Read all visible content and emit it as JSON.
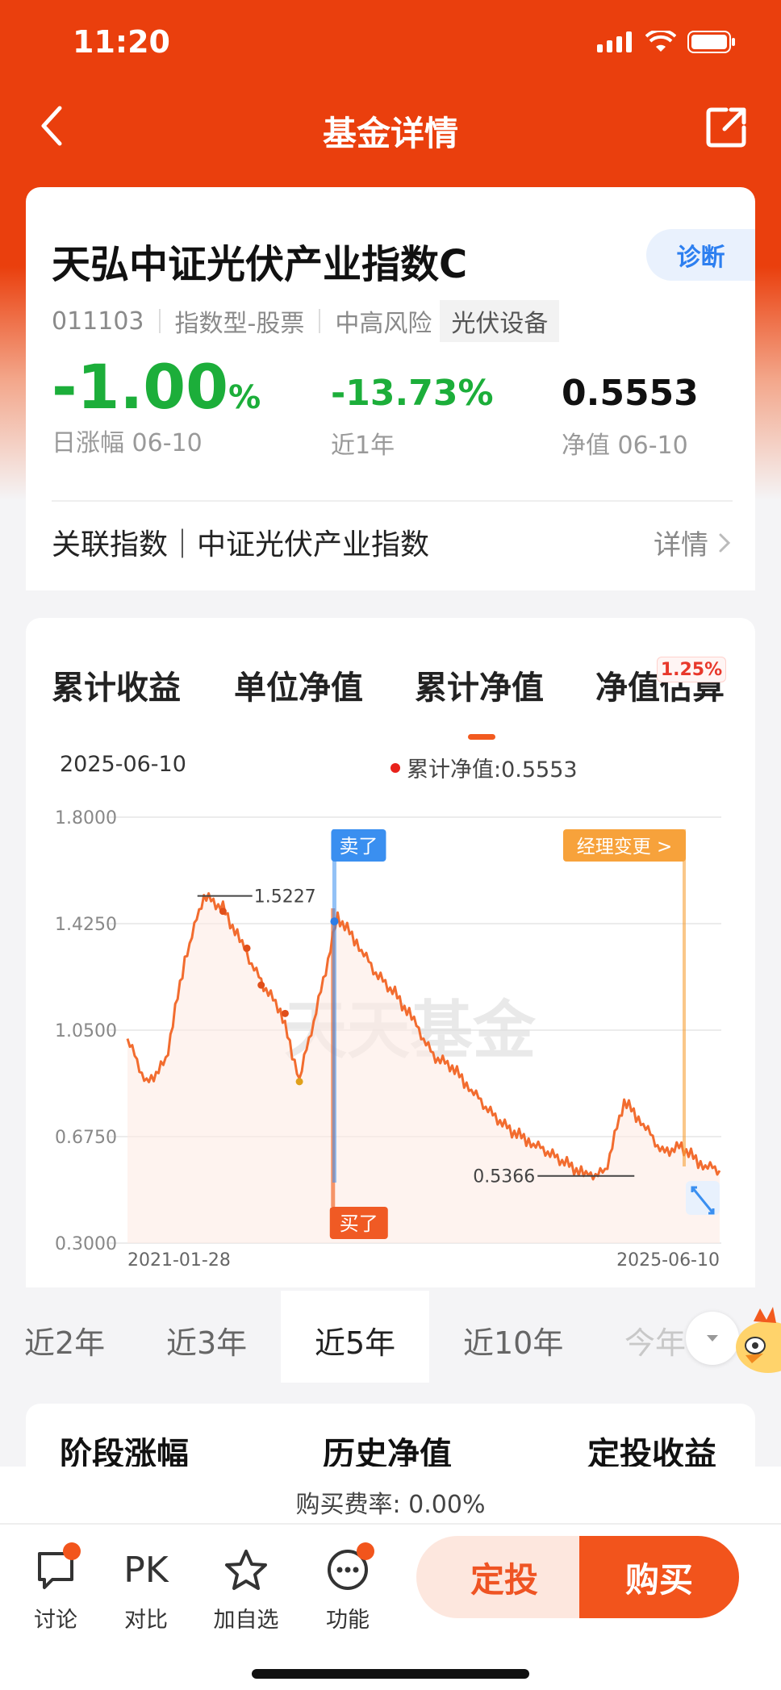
{
  "status": {
    "time": "11:20"
  },
  "nav": {
    "title": "基金详情"
  },
  "fund": {
    "name": "天弘中证光伏产业指数C",
    "code": "011103",
    "type": "指数型-股票",
    "risk": "中高风险",
    "sector": "光伏设备",
    "diagnose_label": "诊断",
    "daily_change": "-1.00",
    "daily_change_unit": "%",
    "daily_change_label": "日涨幅 06-10",
    "year_change": "-13.73%",
    "year_change_label": "近1年",
    "nav_value": "0.5553",
    "nav_label": "净值 06-10",
    "related_index": "关联指数｜中证光伏产业指数",
    "related_more": "详情"
  },
  "chart_tabs": [
    {
      "label": "累计收益"
    },
    {
      "label": "单位净值"
    },
    {
      "label": "累计净值",
      "active": true
    },
    {
      "label": "净值估算",
      "badge": "1.25%"
    }
  ],
  "chart_header": {
    "date": "2025-06-10",
    "legend": "累计净值:0.5553"
  },
  "chart_data": {
    "type": "line",
    "series": [
      {
        "name": "累计净值",
        "x": [
          "2021-01-28",
          "2021-03",
          "2021-05",
          "2021-07",
          "2021-08",
          "2021-09",
          "2021-11",
          "2022-01",
          "2022-03",
          "2022-04",
          "2022-05",
          "2022-07",
          "2022-08",
          "2022-09",
          "2022-11",
          "2023-01",
          "2023-03",
          "2023-05",
          "2023-07",
          "2023-09",
          "2023-11",
          "2024-01",
          "2024-02",
          "2024-04",
          "2024-06",
          "2024-08",
          "2024-09",
          "2024-10",
          "2024-12",
          "2025-02",
          "2025-04",
          "2025-06-10"
        ],
        "y": [
          1.02,
          0.86,
          0.94,
          1.3,
          1.5227,
          1.48,
          1.35,
          1.22,
          1.12,
          0.88,
          1.15,
          1.45,
          1.36,
          1.25,
          1.18,
          1.08,
          0.96,
          0.92,
          0.84,
          0.76,
          0.7,
          0.66,
          0.62,
          0.58,
          0.5366,
          0.55,
          0.8,
          0.72,
          0.62,
          0.64,
          0.58,
          0.5553
        ]
      }
    ],
    "ylim": [
      0.3,
      1.8
    ],
    "yticks": [
      "1.8000",
      "1.4250",
      "1.0500",
      "0.6750",
      "0.3000"
    ],
    "xlabels": [
      "2021-01-28",
      "2025-06-10"
    ],
    "annotations": {
      "max": "1.5227",
      "min": "0.5366",
      "sell": "卖了",
      "buy": "买了",
      "manager": "经理变更 >"
    },
    "watermark": "天天基金",
    "grid": true
  },
  "ranges": [
    {
      "label": "近2年"
    },
    {
      "label": "近3年"
    },
    {
      "label": "近5年",
      "active": true
    },
    {
      "label": "近10年"
    },
    {
      "label": "今年"
    }
  ],
  "sections": [
    "阶段涨幅",
    "历史净值",
    "定投收益"
  ],
  "bottom": {
    "fee": "购买费率: 0.00%",
    "actions": [
      {
        "label": "讨论"
      },
      {
        "label": "对比",
        "icon_text": "PK"
      },
      {
        "label": "加自选"
      },
      {
        "label": "功能"
      }
    ],
    "dingtou": "定投",
    "buy": "购买"
  }
}
